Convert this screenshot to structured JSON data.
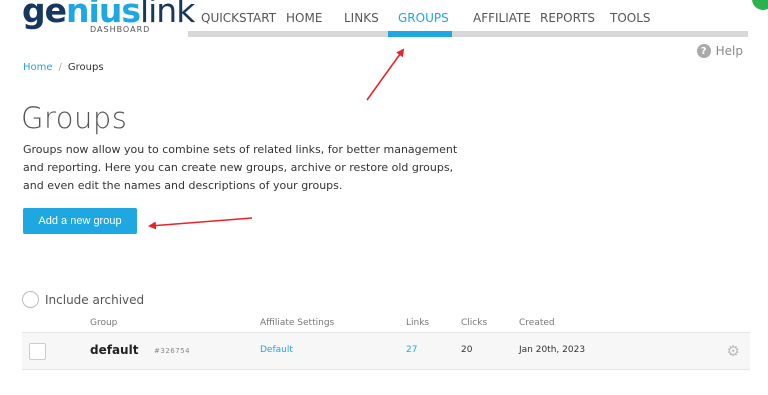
{
  "logo": {
    "text_pre": "ge",
    "text_mid": "nius",
    "text_post": "link",
    "subtitle": "DASHBOARD"
  },
  "nav": {
    "items": [
      "QUICKSTART",
      "HOME",
      "LINKS",
      "GROUPS",
      "AFFILIATE",
      "REPORTS",
      "TOOLS"
    ],
    "active": "GROUPS"
  },
  "help": {
    "icon": "question-icon",
    "label": "Help"
  },
  "breadcrumb": {
    "home": "Home",
    "separator": "/",
    "current": "Groups"
  },
  "page": {
    "title": "Groups",
    "description": "Groups now allow you to combine sets of related links, for better management and reporting. Here you can create new groups, archive or restore old groups, and even edit the names and descriptions of your groups."
  },
  "add_button": {
    "label": "Add a new group"
  },
  "include_archived": {
    "label": "Include archived"
  },
  "table": {
    "headers": {
      "group": "Group",
      "affiliate": "Affiliate Settings",
      "links": "Links",
      "clicks": "Clicks",
      "created": "Created"
    },
    "rows": [
      {
        "name": "default",
        "id": "#326754",
        "affiliate": "Default",
        "links": "27",
        "clicks": "20",
        "created": "Jan 20th, 2023"
      }
    ]
  },
  "colors": {
    "accent": "#1ea7e1",
    "brand_dark": "#17375e",
    "annotation": "#e8232a",
    "status": "#2bb24c"
  }
}
